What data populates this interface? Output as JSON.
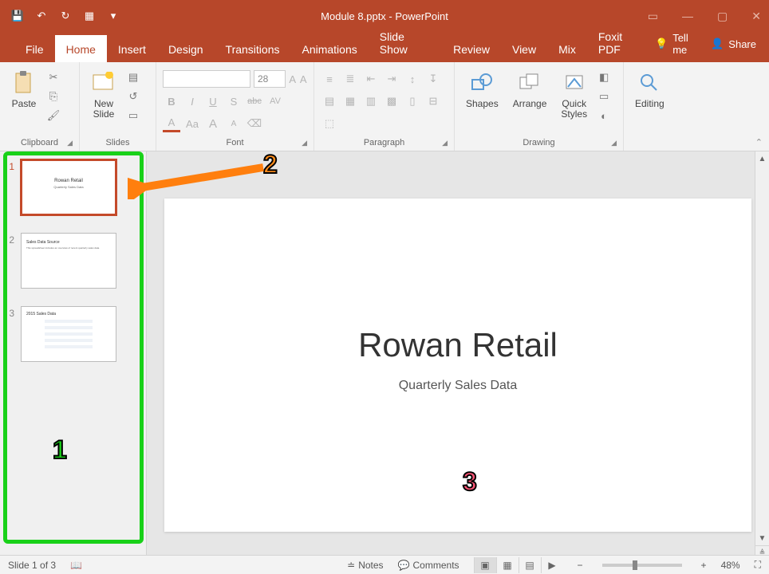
{
  "title": "Module 8.pptx  -  PowerPoint",
  "qat": {
    "save": "💾",
    "undo": "↶",
    "redo": "↻",
    "start": "▦",
    "more": "▾"
  },
  "titlebar_right": {
    "display_settings": "▭",
    "min": "—",
    "max": "▢",
    "close": "✕"
  },
  "tabs": [
    "File",
    "Home",
    "Insert",
    "Design",
    "Transitions",
    "Animations",
    "Slide Show",
    "Review",
    "View",
    "Mix",
    "Foxit PDF"
  ],
  "active_tab": "Home",
  "tellme": "Tell me",
  "share": "Share",
  "ribbon": {
    "clipboard": {
      "label": "Clipboard",
      "paste": "Paste",
      "cut": "✂",
      "copy": "⎘",
      "painter": "🖌"
    },
    "slides": {
      "label": "Slides",
      "new": "New\nSlide",
      "layout": "▤",
      "reset": "↺",
      "section": "▭"
    },
    "font": {
      "label": "Font",
      "size": "28",
      "bold": "B",
      "italic": "I",
      "underline": "U",
      "shadow": "S",
      "strike": "abc",
      "spacing": "AV",
      "color": "A",
      "highlight": "Aa",
      "grow": "A",
      "shrink": "A",
      "clear": "⌫"
    },
    "paragraph": {
      "label": "Paragraph"
    },
    "drawing": {
      "label": "Drawing",
      "shapes": "Shapes",
      "arrange": "Arrange",
      "quick": "Quick\nStyles"
    },
    "editing": {
      "label": "Editing",
      "editing": "Editing"
    }
  },
  "thumbs": [
    {
      "num": "1",
      "title": "Rowan Retail",
      "sub": "Quarterly Sales Data"
    },
    {
      "num": "2",
      "title": "Sales Data Source",
      "body": "This spreadsheet includes an overview of recent quarterly sales data."
    },
    {
      "num": "3",
      "title": "2015 Sales Data"
    }
  ],
  "slide": {
    "title": "Rowan Retail",
    "subtitle": "Quarterly Sales Data"
  },
  "status": {
    "slide": "Slide 1 of 3",
    "notes": "Notes",
    "comments": "Comments",
    "zoom": "48%"
  },
  "annotations": {
    "n1": "1",
    "n2": "2",
    "n3": "3"
  }
}
